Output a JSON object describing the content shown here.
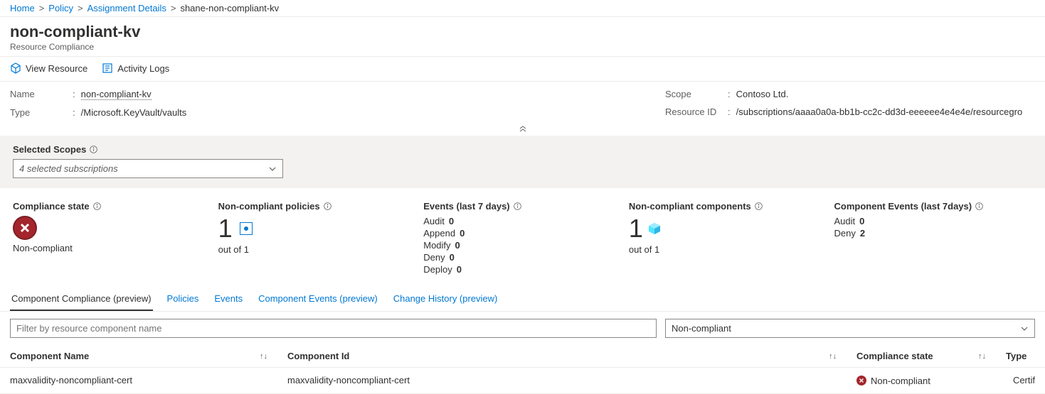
{
  "breadcrumb": {
    "items": [
      "Home",
      "Policy",
      "Assignment Details",
      "shane-non-compliant-kv"
    ]
  },
  "header": {
    "title": "non-compliant-kv",
    "subtitle": "Resource Compliance"
  },
  "toolbar": {
    "view_resource": "View Resource",
    "activity_logs": "Activity Logs"
  },
  "props": {
    "left": {
      "name_label": "Name",
      "name_value": "non-compliant-kv",
      "type_label": "Type",
      "type_value": "/Microsoft.KeyVault/vaults"
    },
    "right": {
      "scope_label": "Scope",
      "scope_value": "Contoso Ltd.",
      "resid_label": "Resource ID",
      "resid_value": "/subscriptions/aaaa0a0a-bb1b-cc2c-dd3d-eeeeee4e4e4e/resourcegro"
    }
  },
  "scope": {
    "title": "Selected Scopes",
    "value": "4 selected subscriptions"
  },
  "stats": {
    "compliance": {
      "title": "Compliance state",
      "value": "Non-compliant"
    },
    "noncomp_policies": {
      "title": "Non-compliant policies",
      "big": "1",
      "caption": "out of 1"
    },
    "events": {
      "title": "Events (last 7 days)",
      "rows": [
        {
          "lbl": "Audit",
          "val": "0"
        },
        {
          "lbl": "Append",
          "val": "0"
        },
        {
          "lbl": "Modify",
          "val": "0"
        },
        {
          "lbl": "Deny",
          "val": "0"
        },
        {
          "lbl": "Deploy",
          "val": "0"
        }
      ]
    },
    "noncomp_components": {
      "title": "Non-compliant components",
      "big": "1",
      "caption": "out of 1"
    },
    "comp_events": {
      "title": "Component Events (last 7days)",
      "rows": [
        {
          "lbl": "Audit",
          "val": "0"
        },
        {
          "lbl": "Deny",
          "val": "2"
        }
      ]
    }
  },
  "tabs": {
    "items": [
      "Component Compliance (preview)",
      "Policies",
      "Events",
      "Component Events (preview)",
      "Change History (preview)"
    ]
  },
  "filters": {
    "placeholder": "Filter by resource component name",
    "compliance": "Non-compliant"
  },
  "table": {
    "cols": {
      "name": "Component Name",
      "id": "Component Id",
      "state": "Compliance state",
      "type": "Type"
    },
    "rows": [
      {
        "name": "maxvalidity-noncompliant-cert",
        "id": "maxvalidity-noncompliant-cert",
        "state": "Non-compliant",
        "type": "Certif"
      }
    ]
  }
}
